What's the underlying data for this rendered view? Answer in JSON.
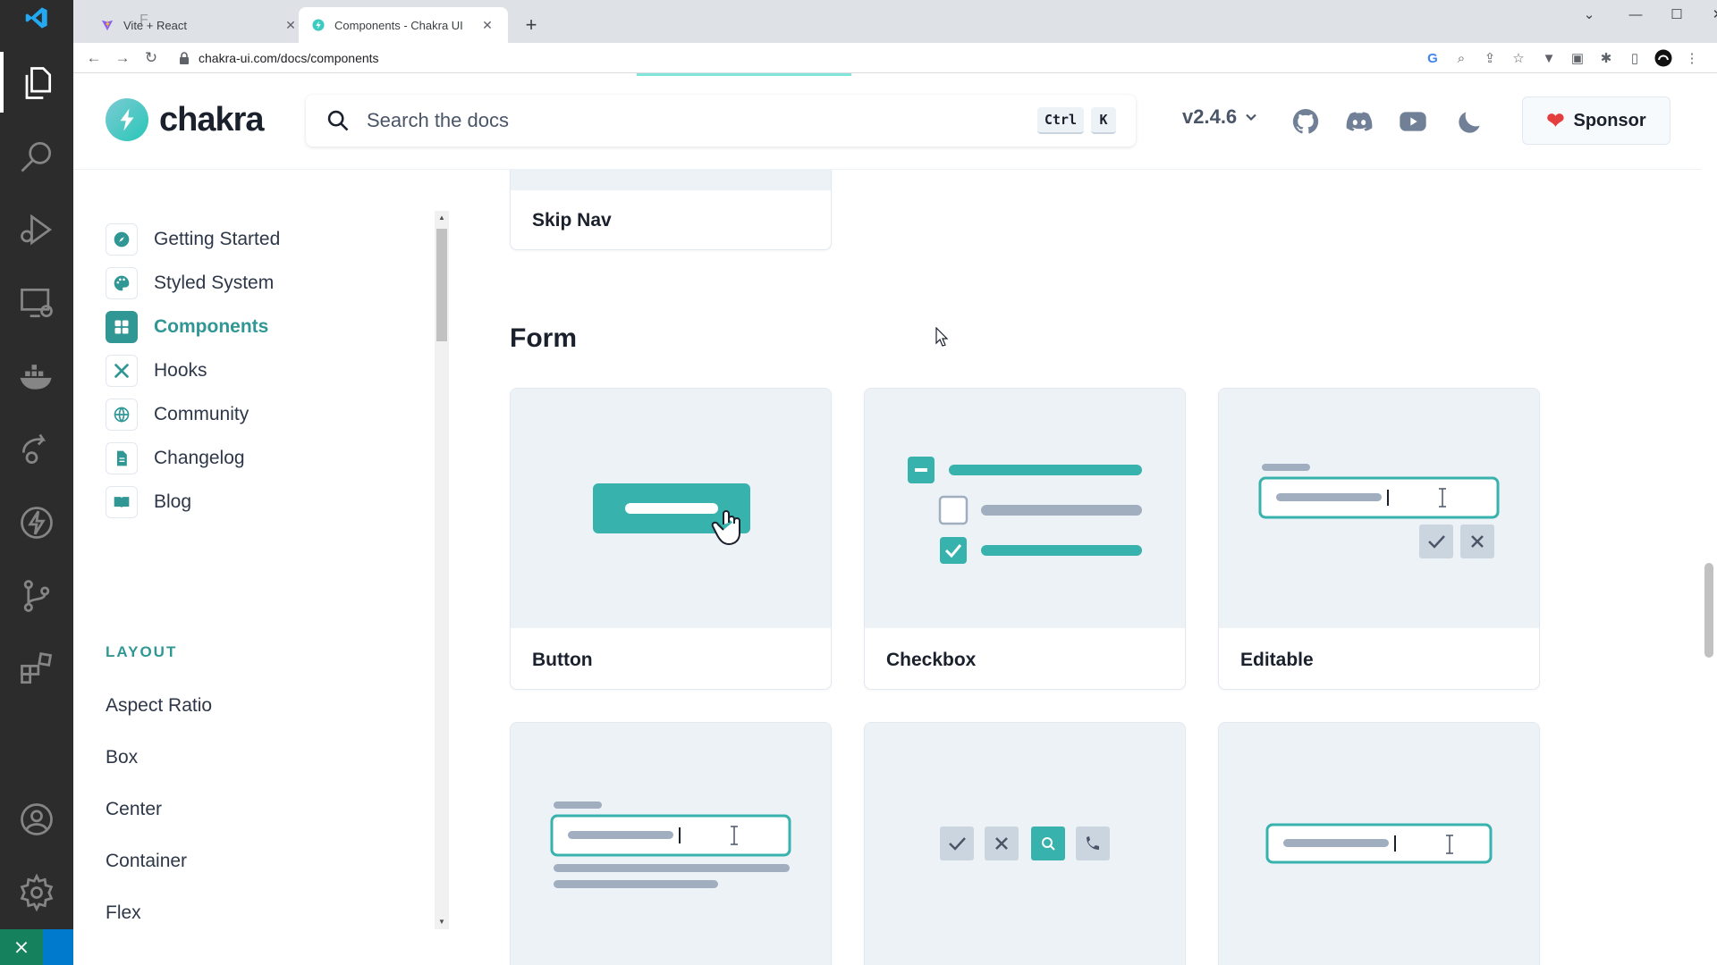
{
  "browser": {
    "tabs": [
      {
        "title": "Vite + React",
        "active": false
      },
      {
        "title": "Components - Chakra UI",
        "active": true
      }
    ],
    "edge_letter": "F",
    "url": "chakra-ui.com/docs/components"
  },
  "header": {
    "logo_text": "chakra",
    "search_placeholder": "Search the docs",
    "shortcut_ctrl": "Ctrl",
    "shortcut_k": "K",
    "version": "v2.4.6",
    "sponsor_label": "Sponsor"
  },
  "sidebar": {
    "items": [
      {
        "label": "Getting Started",
        "icon": "compass-icon"
      },
      {
        "label": "Styled System",
        "icon": "palette-icon"
      },
      {
        "label": "Components",
        "icon": "grid-icon",
        "active": true
      },
      {
        "label": "Hooks",
        "icon": "tools-icon"
      },
      {
        "label": "Community",
        "icon": "globe-icon"
      },
      {
        "label": "Changelog",
        "icon": "document-icon"
      },
      {
        "label": "Blog",
        "icon": "book-icon"
      }
    ],
    "section_heading": "LAYOUT",
    "layout_items": [
      "Aspect Ratio",
      "Box",
      "Center",
      "Container",
      "Flex"
    ]
  },
  "main": {
    "prev_card_label": "Skip Nav",
    "section_title": "Form",
    "cards": [
      {
        "label": "Button"
      },
      {
        "label": "Checkbox"
      },
      {
        "label": "Editable"
      }
    ]
  },
  "colors": {
    "accent": "#319795",
    "thumb_bg": "#edf2f7",
    "text": "#1a202c"
  }
}
